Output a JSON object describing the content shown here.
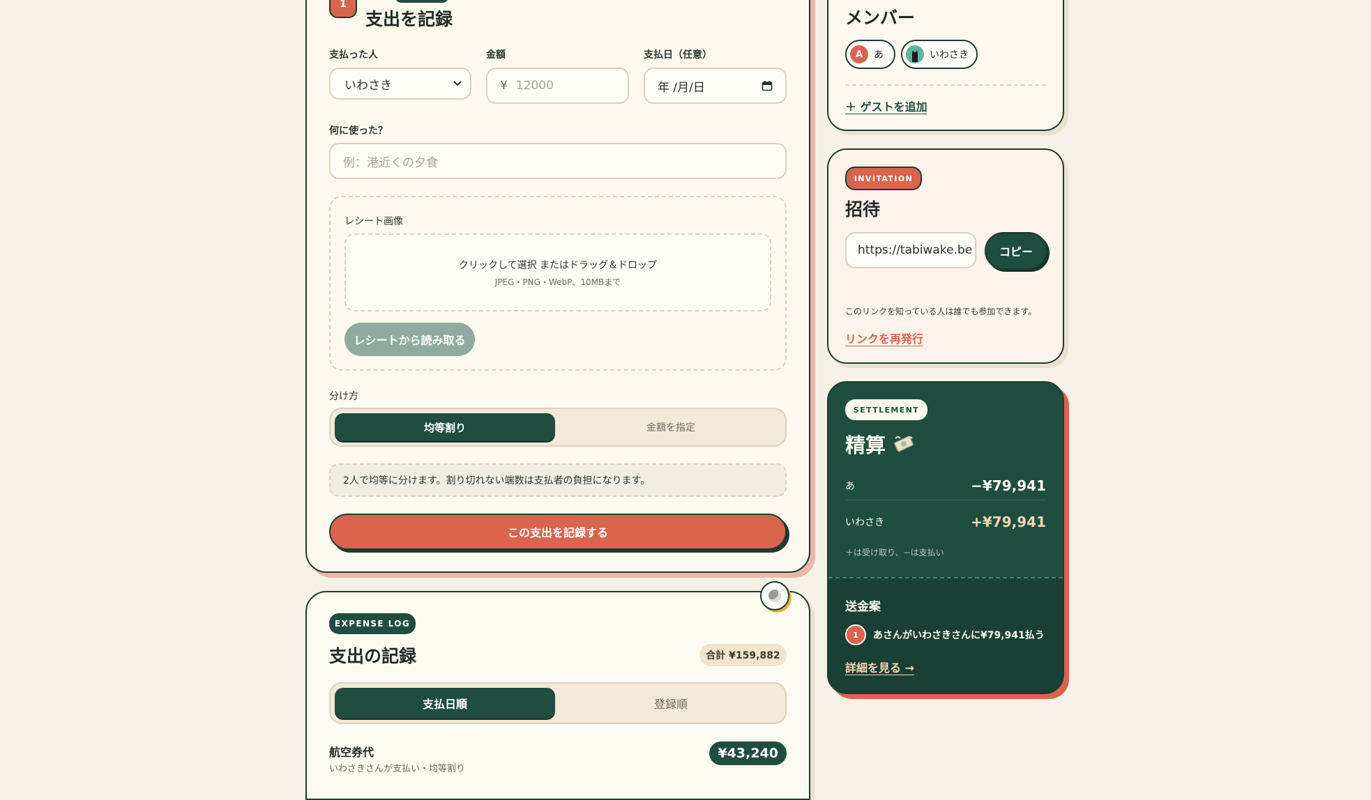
{
  "expense_form": {
    "step_number": "1",
    "title": "支出を記録",
    "payer_label": "支払った人",
    "payer_value": "いわさき",
    "amount_label": "金額",
    "currency_symbol": "¥",
    "amount_placeholder": "12000",
    "date_label": "支払日（任意）",
    "date_placeholder": "年 /月/日",
    "purpose_label": "何に使った？",
    "purpose_placeholder": "例：港近くの夕食",
    "receipt_label": "レシート画像",
    "dropzone_main": "クリックして選択 またはドラッグ＆ドロップ",
    "dropzone_sub": "JPEG・PNG・WebP、10MBまで",
    "read_receipt_button": "レシートから読み取る",
    "split_label": "分け方",
    "split_options": [
      "均等割り",
      "金額を指定"
    ],
    "split_note": "2人で均等に分けます。割り切れない端数は支払者の負担になります。",
    "submit_button": "この支出を記録する"
  },
  "expense_log": {
    "tag": "EXPENSE LOG",
    "title": "支出の記録",
    "total": "合計 ¥159,882",
    "sort_options": [
      "支払日順",
      "登録順"
    ],
    "items": [
      {
        "title": "航空券代",
        "meta": "いわさきさんが支払い・均等割り",
        "amount": "¥43,240"
      }
    ]
  },
  "members": {
    "title": "メンバー",
    "list": [
      {
        "initial": "A",
        "name": "あ"
      },
      {
        "name": "いわさき"
      }
    ],
    "add_guest": "＋ ゲストを追加"
  },
  "invitation": {
    "tag": "INVITATION",
    "title": "招待",
    "url": "https://tabiwake.be",
    "copy_button": "コピー",
    "note": "このリンクを知っている人は誰でも参加できます。",
    "reissue_link": "リンクを再発行"
  },
  "settlement": {
    "tag": "SETTLEMENT",
    "title": "精算",
    "rows": [
      {
        "name": "あ",
        "amount": "−¥79,941"
      },
      {
        "name": "いわさき",
        "amount": "+¥79,941"
      }
    ],
    "note": "＋は受け取り、−は支払い",
    "transfer_title": "送金案",
    "transfers": [
      {
        "index": "1",
        "text": "あさんがいわさきさんに¥79,941払う"
      }
    ],
    "details_link": "詳細を見る →"
  },
  "colors": {
    "accent_green": "#1f4d40",
    "accent_red": "#d9654e",
    "card_bg": "#fdf9ef",
    "page_bg": "#f6f1e6"
  }
}
